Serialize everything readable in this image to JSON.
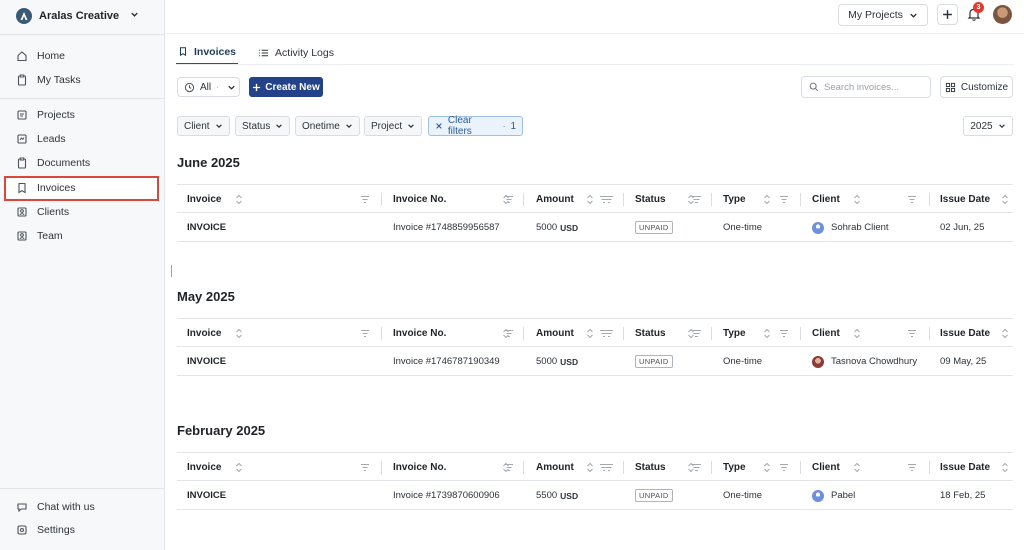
{
  "workspace": {
    "name": "Aralas Creative"
  },
  "sidebar": {
    "items": [
      {
        "label": "Home",
        "icon": "home-icon"
      },
      {
        "label": "My Tasks",
        "icon": "clipboard-icon"
      },
      {
        "label": "Projects",
        "icon": "projects-icon"
      },
      {
        "label": "Leads",
        "icon": "leads-icon"
      },
      {
        "label": "Documents",
        "icon": "document-icon"
      },
      {
        "label": "Invoices",
        "icon": "invoice-icon"
      },
      {
        "label": "Clients",
        "icon": "clients-icon"
      },
      {
        "label": "Team",
        "icon": "team-icon"
      }
    ],
    "active": "Invoices",
    "bottom": [
      {
        "label": "Chat with us",
        "icon": "chat-icon"
      },
      {
        "label": "Settings",
        "icon": "settings-icon"
      }
    ]
  },
  "topbar": {
    "projects_label": "My Projects",
    "notification_count": "3"
  },
  "tabs": [
    {
      "label": "Invoices",
      "active": true
    },
    {
      "label": "Activity Logs",
      "active": false
    }
  ],
  "toolbar": {
    "all_label": "All",
    "create_label": "Create New",
    "search_placeholder": "Search invoices...",
    "customize_label": "Customize"
  },
  "filters": {
    "client": "Client",
    "status": "Status",
    "onetime": "Onetime",
    "project": "Project",
    "clear_label": "Clear filters",
    "clear_count": "1",
    "year": "2025"
  },
  "columns": [
    "Invoice",
    "Invoice No.",
    "Amount",
    "Status",
    "Type",
    "Client",
    "Issue Date"
  ],
  "sections": [
    {
      "title": "June 2025",
      "rows": [
        {
          "invoice": "INVOICE",
          "number": "Invoice #1748859956587",
          "amount": "5000",
          "currency": "USD",
          "status": "UNPAID",
          "type": "One-time",
          "client": "Sohrab Client",
          "date": "02 Jun, 25"
        }
      ]
    },
    {
      "title": "May 2025",
      "rows": [
        {
          "invoice": "INVOICE",
          "number": "Invoice #1746787190349",
          "amount": "5000",
          "currency": "USD",
          "status": "UNPAID",
          "type": "One-time",
          "client": "Tasnova Chowdhury",
          "date": "09 May, 25"
        }
      ]
    },
    {
      "title": "February 2025",
      "rows": [
        {
          "invoice": "INVOICE",
          "number": "Invoice #1739870600906",
          "amount": "5500",
          "currency": "USD",
          "status": "UNPAID",
          "type": "One-time",
          "client": "Pabel",
          "date": "18 Feb, 25"
        }
      ]
    }
  ],
  "colors": {
    "primary": "#23428a",
    "highlight_border": "#d9483b",
    "badge_red": "#e03b2e"
  }
}
